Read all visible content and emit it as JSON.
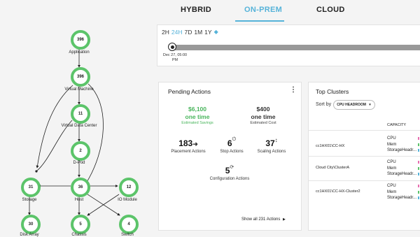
{
  "tabs": {
    "hybrid": "HYBRID",
    "onprem": "ON-PREM",
    "cloud": "CLOUD"
  },
  "timeline": {
    "ranges": [
      "2H",
      "24H",
      "7D",
      "1M",
      "1Y"
    ],
    "active_range": "24H",
    "marker_date": "Dec 27, 05:00",
    "marker_ampm": "PM"
  },
  "graph": {
    "application": {
      "count": "396",
      "label": "Application"
    },
    "vm": {
      "count": "396",
      "label": "Virtual Machine"
    },
    "vdc": {
      "count": "11",
      "label": "Virtual Data Center"
    },
    "dpod": {
      "count": "2",
      "label": "D-Pod"
    },
    "storage": {
      "count": "31",
      "label": "Storage"
    },
    "host": {
      "count": "36",
      "label": "Host"
    },
    "io": {
      "count": "12",
      "label": "IO Module"
    },
    "diskarray": {
      "count": "30",
      "label": "Disk Array"
    },
    "chassis": {
      "count": "5",
      "label": "Chassis"
    },
    "switch": {
      "count": "4",
      "label": "Switch"
    }
  },
  "pending": {
    "title": "Pending Actions",
    "menu_icon": "kebab-menu-icon",
    "savings": {
      "value": "$6,100",
      "freq": "one time",
      "label": "Estimated Savings"
    },
    "cost": {
      "value": "$400",
      "freq": "one time",
      "label": "Estimated Cost"
    },
    "actions": [
      {
        "count": "183",
        "label": "Placement Actions",
        "icon": "arrow-right-icon"
      },
      {
        "count": "6",
        "label": "Stop Actions",
        "icon": "power-icon"
      },
      {
        "count": "37",
        "label": "Scaling Actions",
        "icon": "resize-icon"
      },
      {
        "count": "5",
        "label": "Configuration Actions",
        "icon": "sync-icon"
      }
    ],
    "show_all": "Show all 231 Actions"
  },
  "clusters": {
    "title": "Top Clusters",
    "sort_label": "Sort by",
    "sort_value": "CPU HEADROOM",
    "capacity_header": "CAPACITY",
    "rows": [
      {
        "name": "cc1HX01\\CC-HX",
        "cpu": "CPU",
        "mem": "Mem",
        "storage": "StorageHeadr..."
      },
      {
        "name": "Cloud City\\ClusterA",
        "cpu": "CPU",
        "mem": "Mem",
        "storage": "StorageHeadr..."
      },
      {
        "name": "cc1HX01\\CC-HX-Cluster2",
        "cpu": "CPU",
        "mem": "Mem",
        "storage": "StorageHeadr..."
      }
    ],
    "colors": {
      "cpu": "#e86fb1",
      "mem": "#5cc46a",
      "storage": "#56b3d9"
    }
  }
}
